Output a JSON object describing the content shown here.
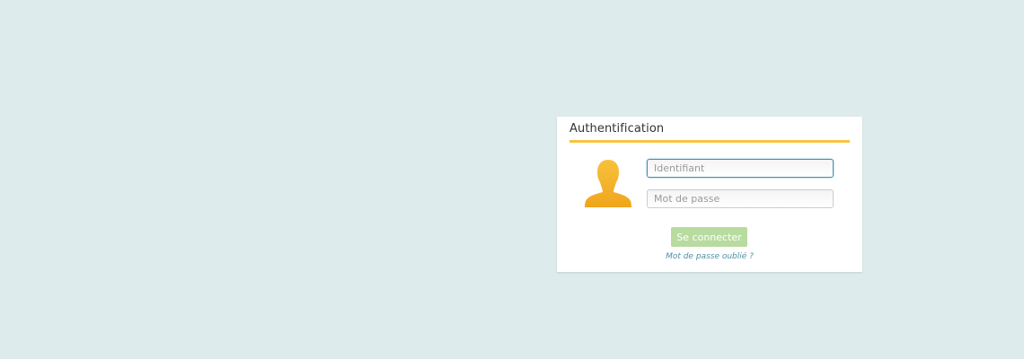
{
  "login": {
    "title": "Authentification",
    "username_placeholder": "Identifiant",
    "password_placeholder": "Mot de passe",
    "submit_label": "Se connecter",
    "forgot_label": "Mot de passe oublié ?"
  },
  "icons": {
    "avatar": "user-icon"
  },
  "colors": {
    "background": "#deebec",
    "accent_rule": "#f7c542",
    "avatar": "#f5b325",
    "button": "#b8dba0",
    "link": "#4f8fa8",
    "focus_border": "#3d8fb0"
  }
}
